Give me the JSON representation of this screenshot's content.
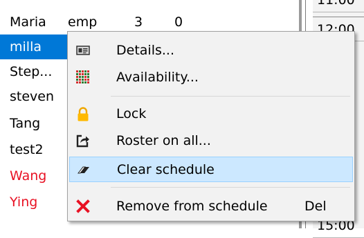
{
  "staff": [
    {
      "name": "Maria",
      "role": "emp",
      "c1": "3",
      "c2": "0"
    },
    {
      "name": "milla",
      "role": "",
      "c1": "",
      "c2": ""
    },
    {
      "name": "Step...",
      "role": "",
      "c1": "",
      "c2": ""
    },
    {
      "name": "steven",
      "role": "",
      "c1": "",
      "c2": ""
    },
    {
      "name": "Tang",
      "role": "",
      "c1": "",
      "c2": ""
    },
    {
      "name": "test2",
      "role": "",
      "c1": "",
      "c2": ""
    },
    {
      "name": "Wang",
      "role": "",
      "c1": "",
      "c2": ""
    },
    {
      "name": "Ying",
      "role": "",
      "c1": "",
      "c2": ""
    }
  ],
  "schedule": {
    "times": [
      "11:00",
      "12:00",
      "15:00"
    ]
  },
  "menu": {
    "details": "Details...",
    "availability": "Availability...",
    "lock": "Lock",
    "roster_all": "Roster on all...",
    "clear": "Clear schedule",
    "remove": "Remove from schedule",
    "remove_shortcut": "Del"
  },
  "icons": {
    "details": "id-card-icon",
    "availability": "availability-grid-icon",
    "lock": "lock-icon",
    "roster_all": "share-arrow-icon",
    "clear": "eraser-icon",
    "remove": "red-x-icon"
  },
  "colors": {
    "selection": "#0078d7",
    "highlight": "#cce8ff",
    "unavailable_name": "#e81123"
  }
}
